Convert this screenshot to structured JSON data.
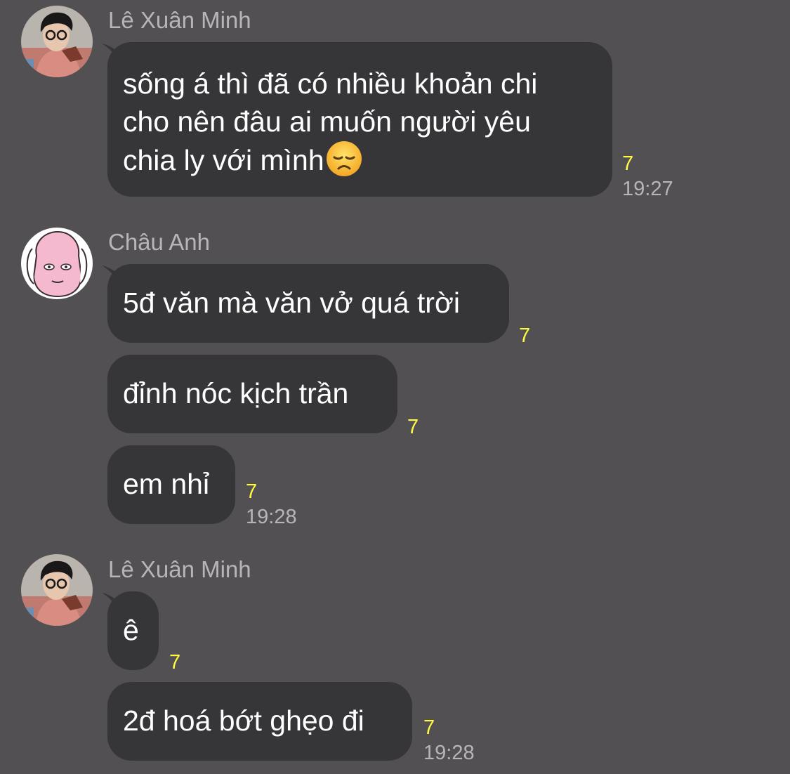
{
  "colors": {
    "background": "#525053",
    "bubble": "#363538",
    "read_count": "#fffb40",
    "meta_text": "#b7b5b9"
  },
  "groups": [
    {
      "sender": "Lê Xuân Minh",
      "avatar": "photo-avatar",
      "messages": [
        {
          "text": "sống á thì đã có nhiều khoản chi\ncho nên đâu ai muốn người yêu\nchia ly với mình",
          "emoji": "disappointed-face-emoji",
          "read": "7",
          "time": "19:27"
        }
      ]
    },
    {
      "sender": "Châu Anh",
      "avatar": "cartoon-pink-face-avatar",
      "messages": [
        {
          "text": "5đ văn mà văn vở quá trời",
          "read": "7"
        },
        {
          "text": "đỉnh nóc kịch trần",
          "read": "7"
        },
        {
          "text": "em nhỉ",
          "read": "7",
          "time": "19:28"
        }
      ]
    },
    {
      "sender": "Lê Xuân Minh",
      "avatar": "photo-avatar",
      "messages": [
        {
          "text": "ê",
          "read": "7"
        },
        {
          "text": "2đ hoá bớt ghẹo đi",
          "read": "7",
          "time": "19:28"
        }
      ]
    }
  ]
}
